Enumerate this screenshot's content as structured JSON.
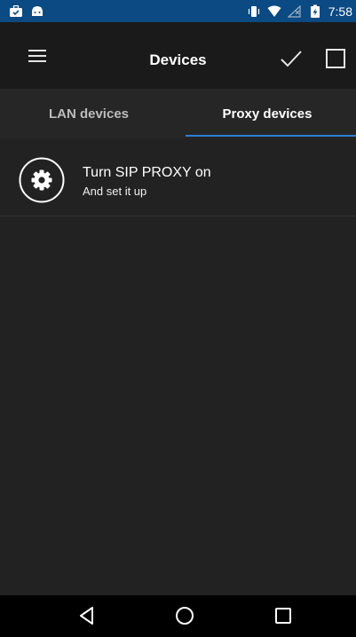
{
  "status_bar": {
    "time": "7:58",
    "icons": [
      "briefcase-icon",
      "android-icon",
      "vibrate-icon",
      "wifi-icon",
      "no-signal-icon",
      "battery-charging-icon"
    ],
    "background": "#0b4a82"
  },
  "toolbar": {
    "title": "Devices",
    "menu_icon": "hamburger-menu-icon",
    "confirm_icon": "checkmark-icon",
    "select_icon": "checkbox-icon"
  },
  "tabs": [
    {
      "label": "LAN devices",
      "selected": false
    },
    {
      "label": "Proxy devices",
      "selected": true
    }
  ],
  "accent_color": "#2a7fd4",
  "list": {
    "items": [
      {
        "icon": "gear-icon",
        "title": "Turn SIP PROXY on",
        "subtitle": "And set it up"
      }
    ]
  },
  "nav_bar": {
    "buttons": [
      "back-icon",
      "home-icon",
      "recent-apps-icon"
    ]
  }
}
